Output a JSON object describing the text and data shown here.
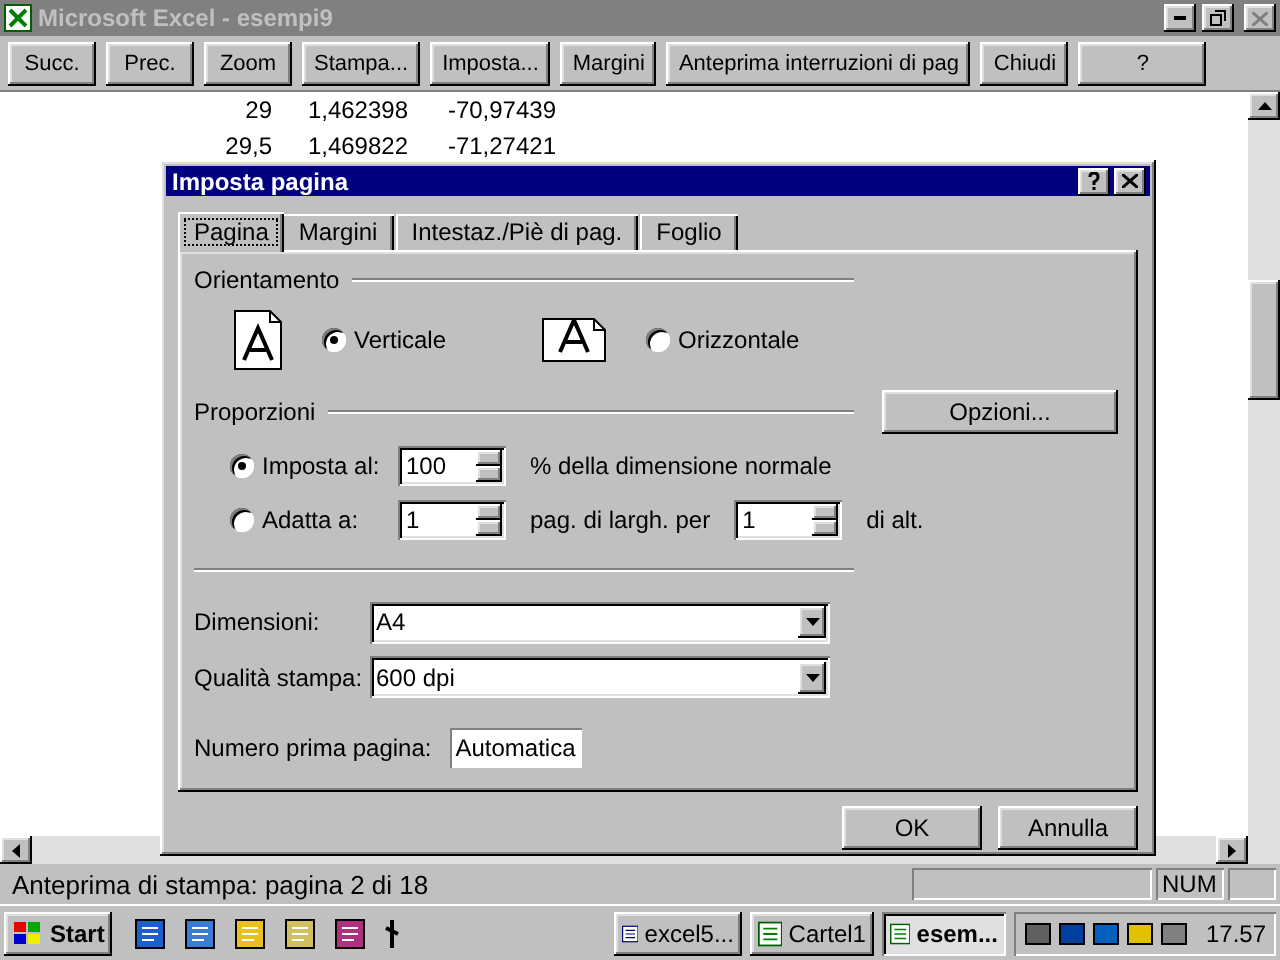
{
  "window": {
    "title": "Microsoft Excel - esempi9"
  },
  "toolbar": {
    "buttons": [
      "Succ.",
      "Prec.",
      "Zoom",
      "Stampa...",
      "Imposta...",
      "Margini",
      "Anteprima interruzioni di pag",
      "Chiudi",
      "?"
    ]
  },
  "sheet": {
    "rows": [
      [
        "29",
        "1,462398",
        "-70,97439"
      ],
      [
        "29,5",
        "1,469822",
        "-71,27421"
      ]
    ]
  },
  "dialog": {
    "title": "Imposta pagina",
    "tabs": [
      {
        "label": "Pagina",
        "selected": true
      },
      {
        "label": "Margini",
        "selected": false
      },
      {
        "label": "Intestaz./Piè di pag.",
        "selected": false
      },
      {
        "label": "Foglio",
        "selected": false
      }
    ],
    "orientation": {
      "heading": "Orientamento",
      "options": [
        {
          "kind": "portrait",
          "label": "Verticale",
          "selected": true
        },
        {
          "kind": "landscape",
          "label": "Orizzontale",
          "selected": false
        }
      ]
    },
    "scaling": {
      "heading": "Proporzioni",
      "options_button": "Opzioni...",
      "rows": [
        {
          "label": "Imposta al:",
          "selected": true,
          "parts": [
            {
              "kind": "spin",
              "value": "100"
            },
            {
              "kind": "text",
              "text": "% della dimensione normale"
            }
          ]
        },
        {
          "label": "Adatta a:",
          "selected": false,
          "parts": [
            {
              "kind": "spin",
              "value": "1"
            },
            {
              "kind": "text",
              "text": "pag. di largh. per"
            },
            {
              "kind": "spin",
              "value": "1"
            },
            {
              "kind": "text",
              "text": "di alt."
            }
          ]
        }
      ]
    },
    "paper_size": {
      "label": "Dimensioni:",
      "value": "A4"
    },
    "print_quality": {
      "label": "Qualità stampa:",
      "value": "600 dpi"
    },
    "first_page": {
      "label": "Numero prima pagina:",
      "value": "Automatica"
    },
    "buttons": [
      "OK",
      "Annulla"
    ]
  },
  "status_bar": {
    "text": "Anteprima di stampa: pagina 2 di 18",
    "indicators": [
      "NUM"
    ]
  },
  "taskbar": {
    "start": "Start",
    "tasks": [
      {
        "label": "excel5...",
        "selected": false
      },
      {
        "label": "Cartel1",
        "selected": false
      },
      {
        "label": "esem...",
        "selected": true
      }
    ],
    "clock": "17.57"
  }
}
